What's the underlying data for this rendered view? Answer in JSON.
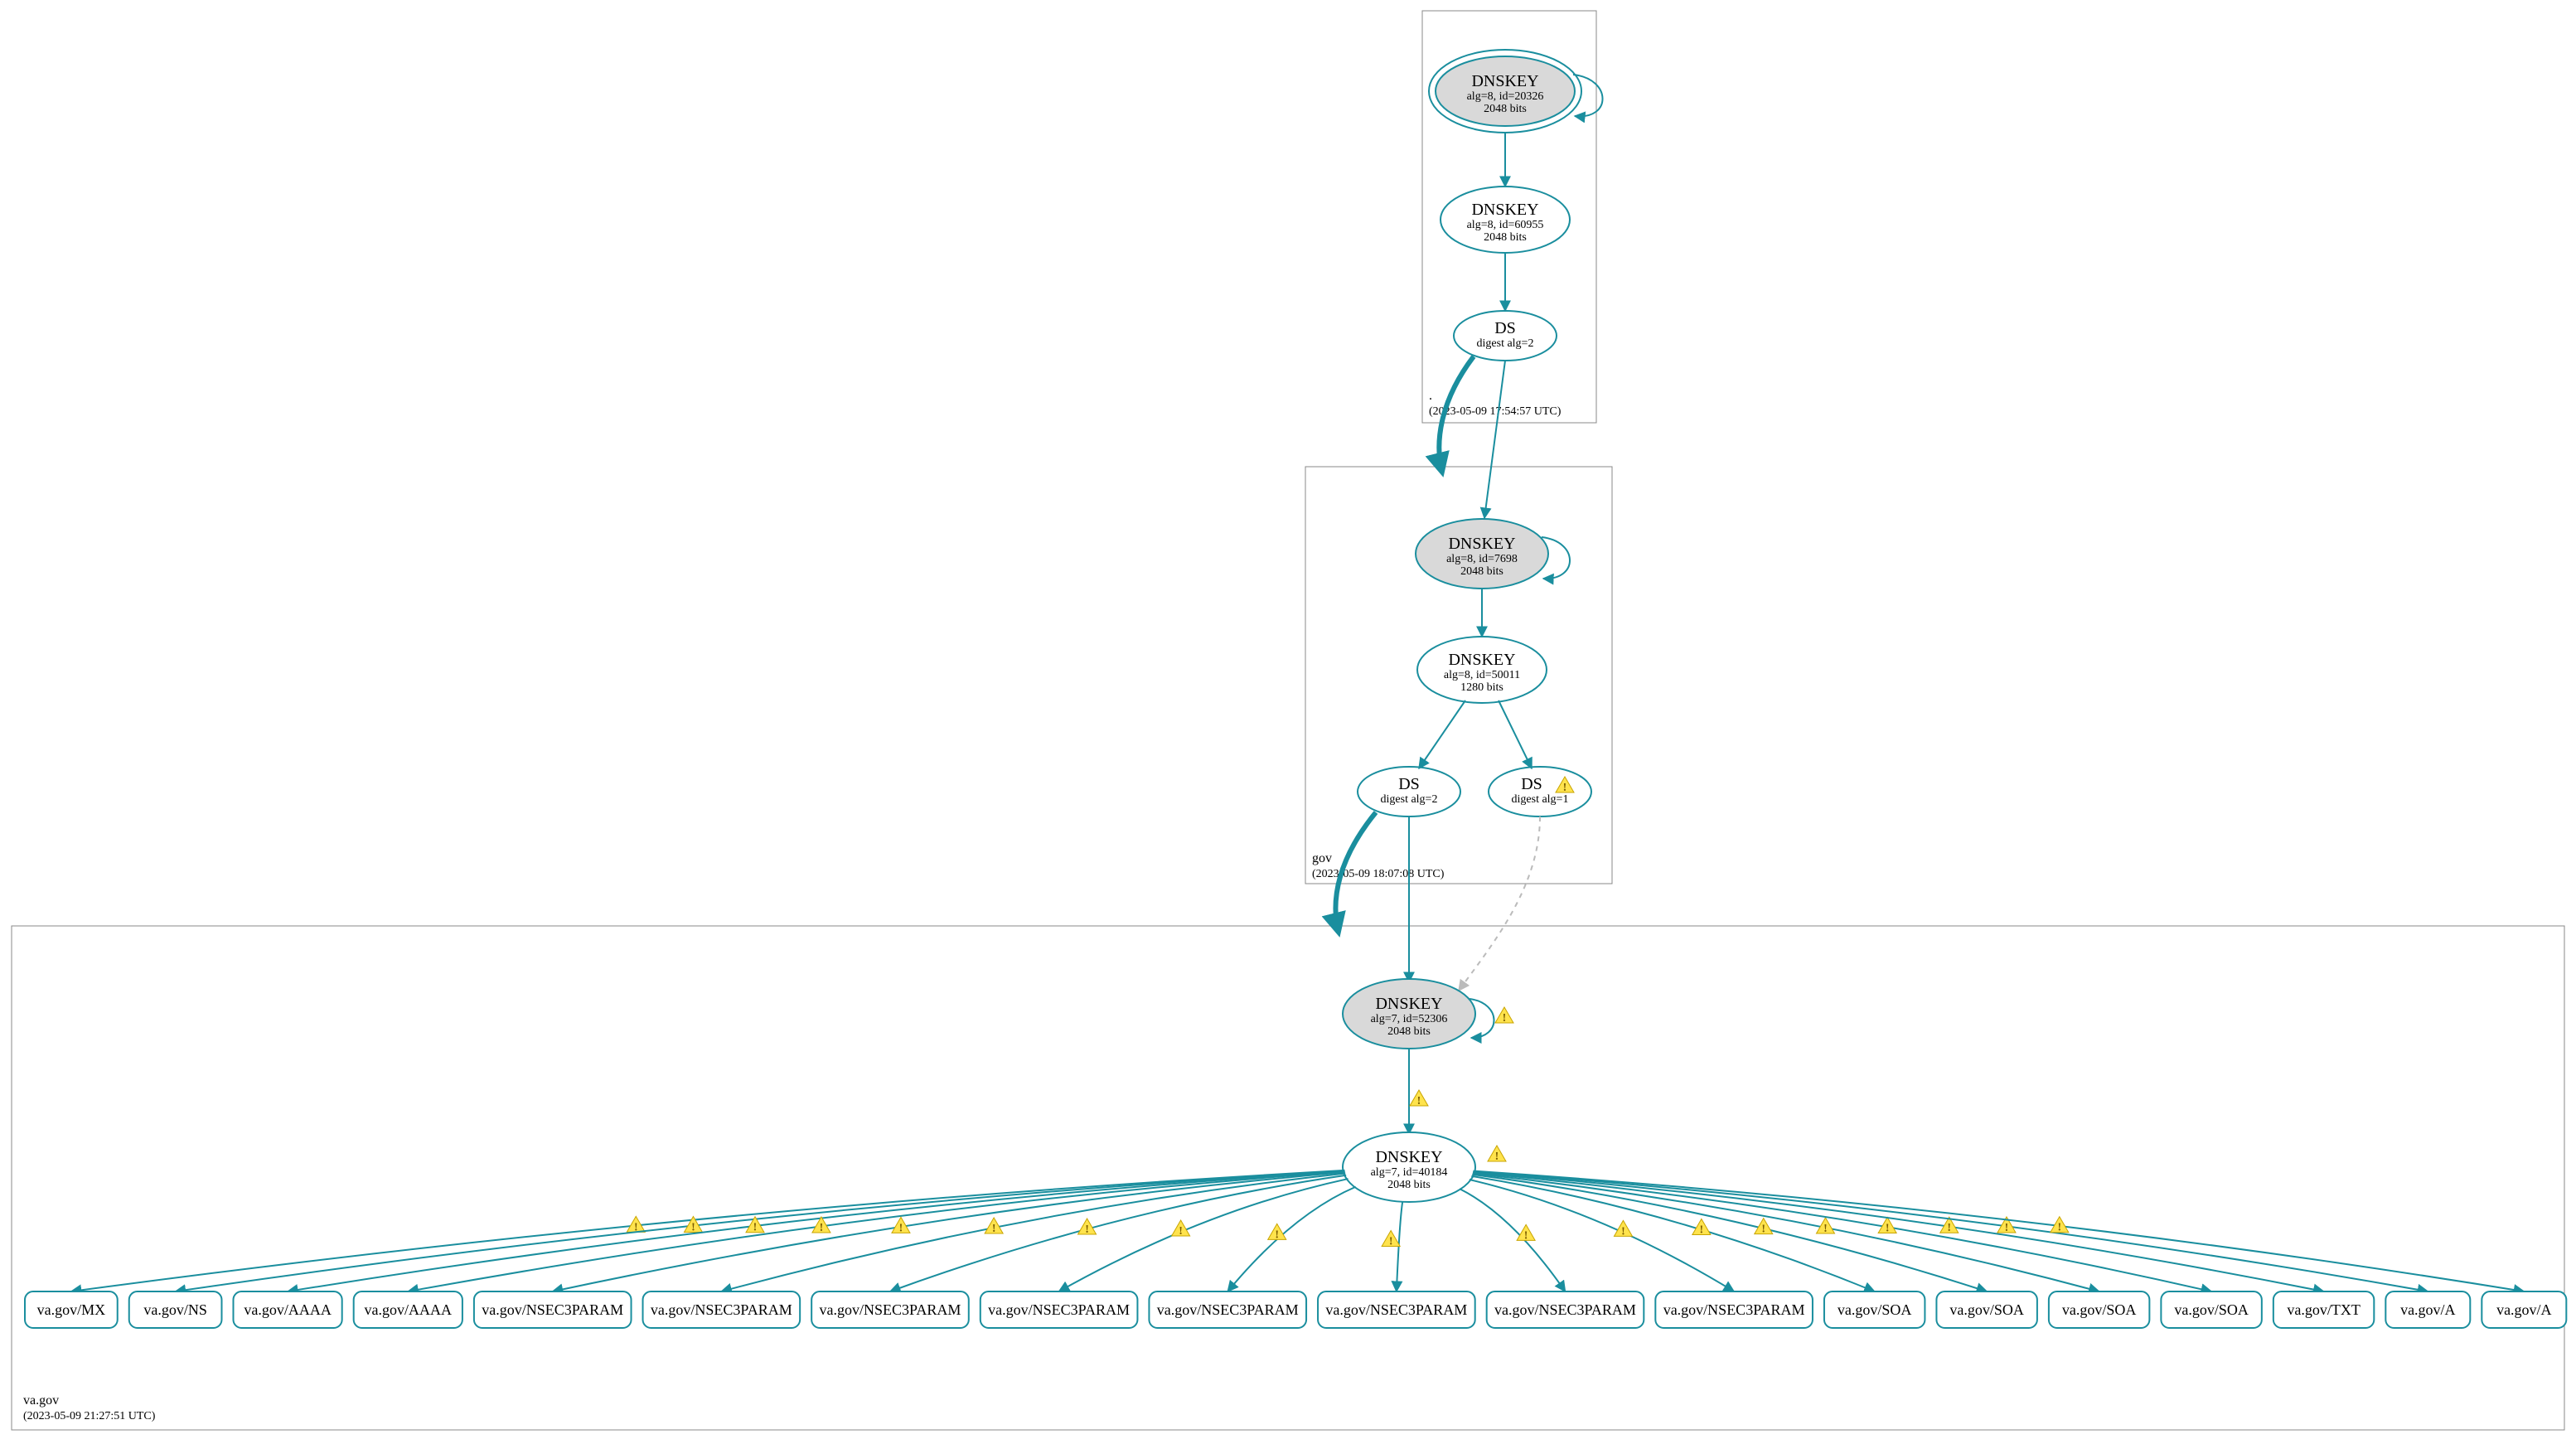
{
  "colors": {
    "teal": "#1a8e9e",
    "ksk_fill": "#d9d9d9"
  },
  "clusters": {
    "root": {
      "label": ".",
      "timestamp": "(2023-05-09 17:54:57 UTC)"
    },
    "gov": {
      "label": "gov",
      "timestamp": "(2023-05-09 18:07:08 UTC)"
    },
    "vagov": {
      "label": "va.gov",
      "timestamp": "(2023-05-09 21:27:51 UTC)"
    }
  },
  "nodes": {
    "root_ksk": {
      "title": "DNSKEY",
      "line1": "alg=8, id=20326",
      "line2": "2048 bits"
    },
    "root_zsk": {
      "title": "DNSKEY",
      "line1": "alg=8, id=60955",
      "line2": "2048 bits"
    },
    "root_ds": {
      "title": "DS",
      "line1": "digest alg=2",
      "line2": ""
    },
    "gov_ksk": {
      "title": "DNSKEY",
      "line1": "alg=8, id=7698",
      "line2": "2048 bits"
    },
    "gov_zsk": {
      "title": "DNSKEY",
      "line1": "alg=8, id=50011",
      "line2": "1280 bits"
    },
    "gov_ds1": {
      "title": "DS",
      "line1": "digest alg=2",
      "line2": ""
    },
    "gov_ds2": {
      "title": "DS",
      "line1": "digest alg=1",
      "line2": ""
    },
    "va_ksk": {
      "title": "DNSKEY",
      "line1": "alg=7, id=52306",
      "line2": "2048 bits"
    },
    "va_zsk": {
      "title": "DNSKEY",
      "line1": "alg=7, id=40184",
      "line2": "2048 bits"
    }
  },
  "rrsets": [
    "va.gov/MX",
    "va.gov/NS",
    "va.gov/AAAA",
    "va.gov/AAAA",
    "va.gov/NSEC3PARAM",
    "va.gov/NSEC3PARAM",
    "va.gov/NSEC3PARAM",
    "va.gov/NSEC3PARAM",
    "va.gov/NSEC3PARAM",
    "va.gov/NSEC3PARAM",
    "va.gov/NSEC3PARAM",
    "va.gov/NSEC3PARAM",
    "va.gov/SOA",
    "va.gov/SOA",
    "va.gov/SOA",
    "va.gov/SOA",
    "va.gov/TXT",
    "va.gov/A",
    "va.gov/A"
  ]
}
